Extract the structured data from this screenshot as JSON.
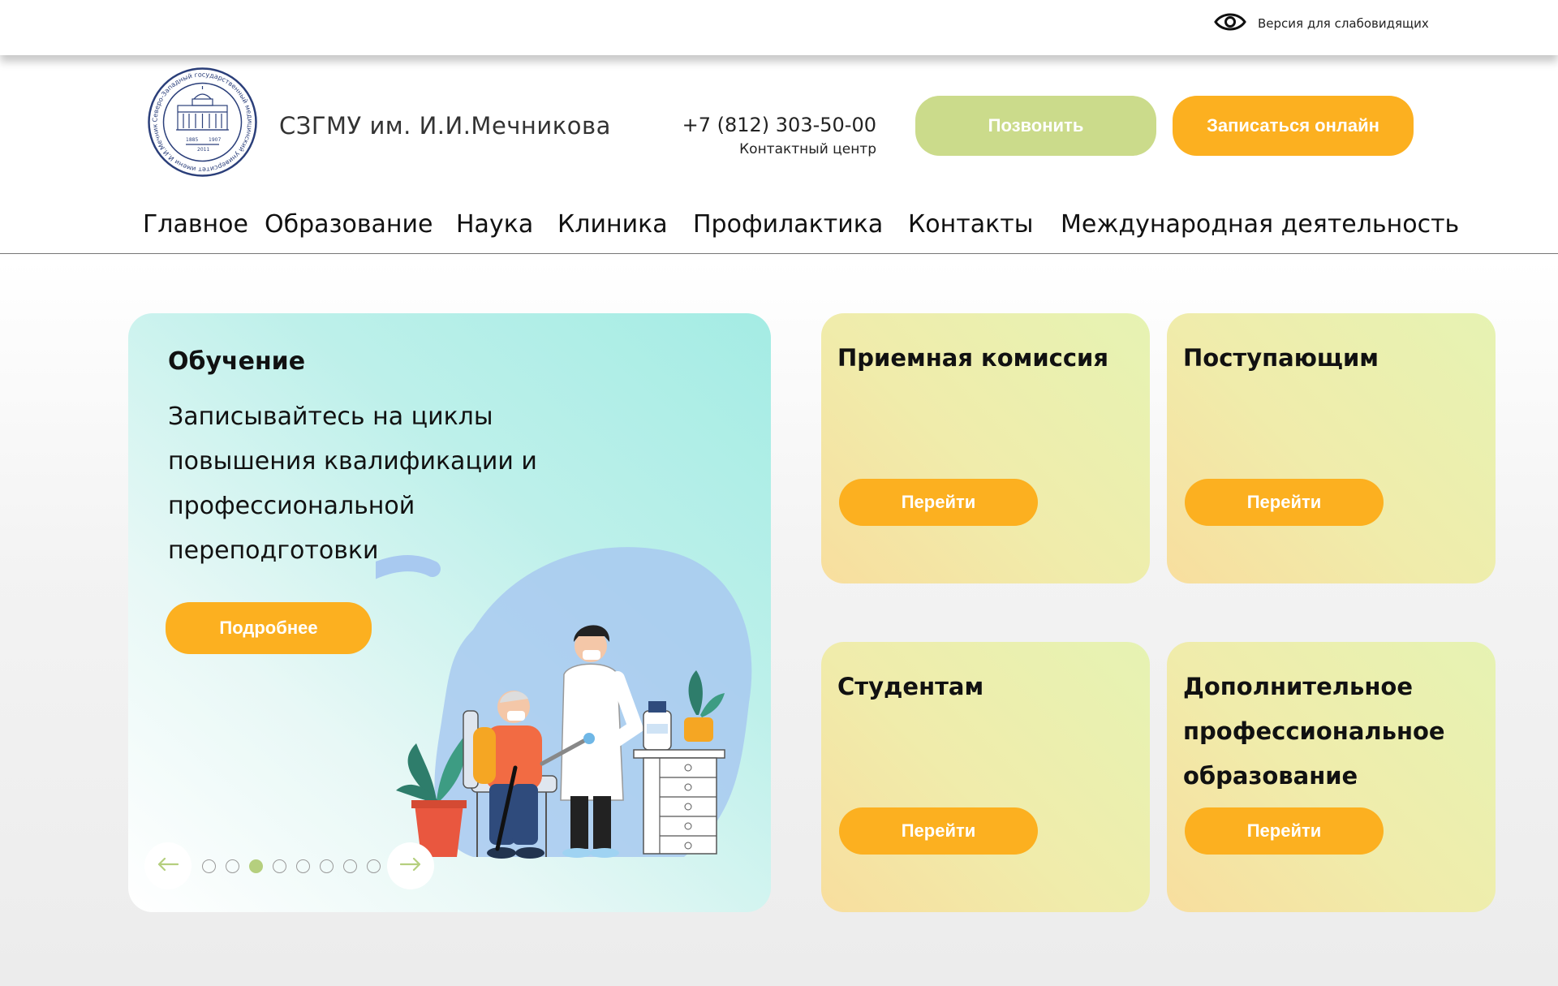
{
  "topbar": {
    "accessibility_label": "Версия для слабовидящих"
  },
  "header": {
    "brand": "СЗГМУ им. И.И.Мечникова",
    "phone": "+7 (812) 303-50-00",
    "phone_caption": "Контактный центр",
    "call_button": "Позвонить",
    "book_button": "Записаться онлайн"
  },
  "logo": {
    "ring_text": "Северо-Западный государственный медицинский университет имени И.И.Мечникова",
    "years_left": "1885",
    "years_right": "1907",
    "year_bottom": "2011"
  },
  "nav": {
    "items": [
      "Главное",
      "Образование",
      "Наука",
      "Клиника",
      "Профилактика",
      "Контакты",
      "Международная деятельность"
    ]
  },
  "hero": {
    "title": "Обучение",
    "text": "Записывайтесь на циклы повышения квалификации и профессиональной переподготовки",
    "button": "Подробнее",
    "slides_total": 8,
    "active_slide": 3
  },
  "cards": [
    {
      "title": "Приемная комиссия",
      "button": "Перейти"
    },
    {
      "title": "Поступающим",
      "button": "Перейти"
    },
    {
      "title": "Студентам",
      "button": "Перейти"
    },
    {
      "title": "Дополнительное профессиональное образование",
      "button": "Перейти"
    }
  ],
  "colors": {
    "accent_orange": "#fcb020",
    "accent_green": "#cbdb8b",
    "active_dot": "#b5cf7e",
    "logo_blue": "#2b3f7a"
  }
}
